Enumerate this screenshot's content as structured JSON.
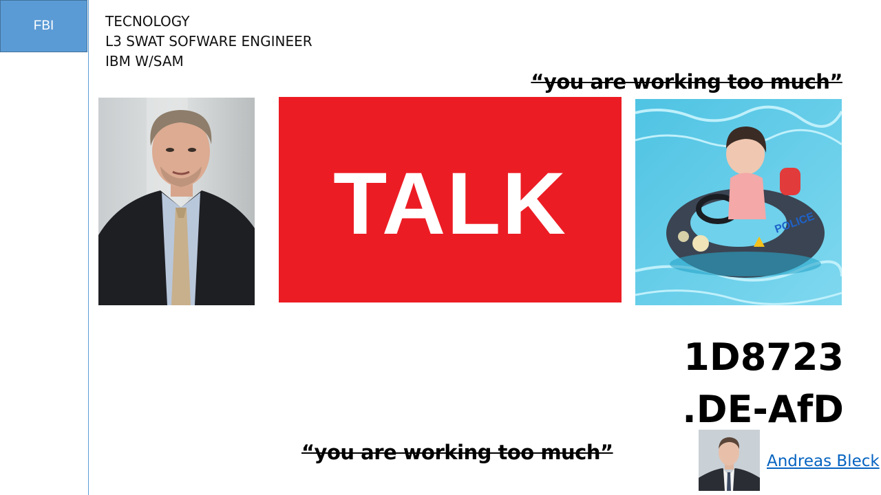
{
  "sidebar": {
    "label": "FBI"
  },
  "header": {
    "lines": [
      "TECNOLOGY",
      "L3 SWAT SOFWARE ENGINEER",
      "IBM W/SAM"
    ]
  },
  "quotes": {
    "top": "“you are working too much”",
    "bottom": "“you are working too much”"
  },
  "talk_banner": {
    "text": "TALK",
    "bg_color": "#ec1c24"
  },
  "pool_photo": {
    "float_text": "POLICE"
  },
  "code": {
    "line1": "1D8723",
    "line2": ".DE-AfD"
  },
  "profile_link": {
    "text": "Andreas Bleck",
    "color": "#0563c1"
  },
  "colors": {
    "accent": "#5b9bd5"
  }
}
